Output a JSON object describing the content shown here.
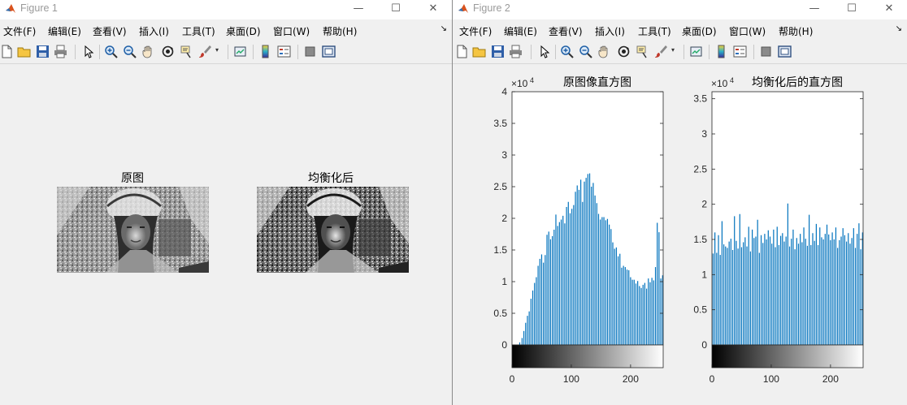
{
  "windows": [
    {
      "title": "Figure 1",
      "menu": [
        "文件(F)",
        "编辑(E)",
        "查看(V)",
        "插入(I)",
        "工具(T)",
        "桌面(D)",
        "窗口(W)",
        "帮助(H)"
      ],
      "images": [
        {
          "title": "原图"
        },
        {
          "title": "均衡化后"
        }
      ]
    },
    {
      "title": "Figure 2",
      "menu": [
        "文件(F)",
        "编辑(E)",
        "查看(V)",
        "插入(I)",
        "工具(T)",
        "桌面(D)",
        "窗口(W)",
        "帮助(H)"
      ]
    }
  ],
  "toolbar_icons": [
    "new-file-icon",
    "open-folder-icon",
    "save-icon",
    "print-icon",
    "arrow-pointer-icon",
    "zoom-in-icon",
    "zoom-out-icon",
    "pan-hand-icon",
    "rotate-3d-icon",
    "data-cursor-icon",
    "brush-icon",
    "brush-dropdown-icon",
    "link-plot-icon",
    "colorbar-icon",
    "legend-icon",
    "hide-plot-tools-icon",
    "show-plot-tools-icon"
  ],
  "window_controls": {
    "minimize": "—",
    "maximize": "☐",
    "close": "✕"
  },
  "colors": {
    "bar": "#0072bd",
    "axes": "#262626",
    "title_inactive": "#9a9a9a"
  },
  "chart_data": [
    {
      "type": "bar",
      "title": "原图像直方图",
      "exponent_label": "×10",
      "exponent": "4",
      "xlim": [
        0,
        255
      ],
      "ylim": [
        0,
        40000
      ],
      "xticks": [
        "0",
        "100",
        "200"
      ],
      "xtick_values": [
        0,
        100,
        200
      ],
      "yticks": [
        "0",
        "0.5",
        "1",
        "1.5",
        "2",
        "2.5",
        "3",
        "3.5",
        "4"
      ],
      "ytick_values": [
        0,
        5000,
        10000,
        15000,
        20000,
        25000,
        30000,
        35000,
        40000
      ],
      "colorbar": "gray",
      "bins": [
        [
          13,
          400
        ],
        [
          17,
          1100
        ],
        [
          20,
          2200
        ],
        [
          23,
          3500
        ],
        [
          26,
          4600
        ],
        [
          29,
          5300
        ],
        [
          32,
          7300
        ],
        [
          35,
          8600
        ],
        [
          38,
          9800
        ],
        [
          41,
          10700
        ],
        [
          44,
          12500
        ],
        [
          47,
          13600
        ],
        [
          50,
          14300
        ],
        [
          53,
          13000
        ],
        [
          56,
          14200
        ],
        [
          59,
          17400
        ],
        [
          62,
          17900
        ],
        [
          65,
          16700
        ],
        [
          68,
          17200
        ],
        [
          71,
          18200
        ],
        [
          74,
          20600
        ],
        [
          77,
          18800
        ],
        [
          80,
          19400
        ],
        [
          83,
          19800
        ],
        [
          86,
          20400
        ],
        [
          89,
          19200
        ],
        [
          92,
          21800
        ],
        [
          95,
          22600
        ],
        [
          98,
          20800
        ],
        [
          101,
          21500
        ],
        [
          104,
          22100
        ],
        [
          107,
          24200
        ],
        [
          110,
          25200
        ],
        [
          113,
          24500
        ],
        [
          116,
          26100
        ],
        [
          119,
          22600
        ],
        [
          122,
          25800
        ],
        [
          125,
          26400
        ],
        [
          128,
          27000
        ],
        [
          131,
          27100
        ],
        [
          134,
          25000
        ],
        [
          137,
          25600
        ],
        [
          140,
          23600
        ],
        [
          143,
          22400
        ],
        [
          146,
          20700
        ],
        [
          149,
          19800
        ],
        [
          152,
          20200
        ],
        [
          155,
          20200
        ],
        [
          158,
          19700
        ],
        [
          161,
          19900
        ],
        [
          164,
          19000
        ],
        [
          167,
          18300
        ],
        [
          170,
          16200
        ],
        [
          173,
          15200
        ],
        [
          176,
          15400
        ],
        [
          179,
          14000
        ],
        [
          182,
          14400
        ],
        [
          185,
          12200
        ],
        [
          188,
          12500
        ],
        [
          191,
          12300
        ],
        [
          194,
          11900
        ],
        [
          197,
          11800
        ],
        [
          200,
          10700
        ],
        [
          203,
          10300
        ],
        [
          206,
          10300
        ],
        [
          209,
          9700
        ],
        [
          212,
          10100
        ],
        [
          215,
          9300
        ],
        [
          218,
          9000
        ],
        [
          221,
          9500
        ],
        [
          224,
          9800
        ],
        [
          227,
          8900
        ],
        [
          230,
          10500
        ],
        [
          233,
          9900
        ],
        [
          236,
          10600
        ],
        [
          239,
          10200
        ],
        [
          242,
          12300
        ],
        [
          245,
          19300
        ],
        [
          248,
          17800
        ],
        [
          251,
          10500
        ],
        [
          254,
          11000
        ]
      ]
    },
    {
      "type": "bar",
      "title": "均衡化后的直方图",
      "exponent_label": "×10",
      "exponent": "4",
      "xlim": [
        0,
        255
      ],
      "ylim": [
        0,
        36000
      ],
      "xticks": [
        "0",
        "100",
        "200"
      ],
      "xtick_values": [
        0,
        100,
        200
      ],
      "yticks": [
        "0",
        "0.5",
        "1",
        "1.5",
        "2",
        "2.5",
        "3",
        "3.5"
      ],
      "ytick_values": [
        0,
        5000,
        10000,
        15000,
        20000,
        25000,
        30000,
        35000
      ],
      "colorbar": "gray",
      "bins": [
        [
          2,
          13000
        ],
        [
          5,
          16000
        ],
        [
          8,
          13100
        ],
        [
          11,
          15600
        ],
        [
          14,
          12800
        ],
        [
          17,
          17600
        ],
        [
          20,
          14300
        ],
        [
          23,
          14000
        ],
        [
          26,
          13800
        ],
        [
          29,
          14700
        ],
        [
          32,
          15100
        ],
        [
          35,
          13500
        ],
        [
          38,
          18300
        ],
        [
          41,
          14800
        ],
        [
          44,
          13700
        ],
        [
          47,
          18600
        ],
        [
          50,
          13900
        ],
        [
          53,
          14600
        ],
        [
          56,
          15300
        ],
        [
          59,
          14000
        ],
        [
          62,
          16800
        ],
        [
          65,
          13300
        ],
        [
          68,
          16400
        ],
        [
          71,
          15200
        ],
        [
          74,
          15400
        ],
        [
          77,
          17800
        ],
        [
          80,
          13100
        ],
        [
          83,
          15600
        ],
        [
          86,
          14500
        ],
        [
          89,
          15800
        ],
        [
          92,
          15000
        ],
        [
          95,
          16300
        ],
        [
          98,
          15400
        ],
        [
          101,
          14400
        ],
        [
          104,
          16400
        ],
        [
          107,
          13900
        ],
        [
          110,
          16800
        ],
        [
          113,
          14200
        ],
        [
          116,
          15500
        ],
        [
          119,
          15900
        ],
        [
          122,
          14700
        ],
        [
          125,
          15400
        ],
        [
          128,
          20100
        ],
        [
          131,
          14000
        ],
        [
          134,
          15100
        ],
        [
          137,
          16400
        ],
        [
          140,
          13600
        ],
        [
          143,
          15200
        ],
        [
          146,
          14400
        ],
        [
          149,
          15800
        ],
        [
          152,
          14600
        ],
        [
          155,
          16700
        ],
        [
          158,
          15100
        ],
        [
          161,
          14100
        ],
        [
          164,
          18500
        ],
        [
          167,
          14200
        ],
        [
          170,
          15900
        ],
        [
          173,
          14800
        ],
        [
          176,
          17200
        ],
        [
          179,
          14200
        ],
        [
          182,
          16700
        ],
        [
          185,
          15300
        ],
        [
          188,
          15000
        ],
        [
          191,
          15800
        ],
        [
          194,
          17100
        ],
        [
          197,
          15700
        ],
        [
          200,
          14900
        ],
        [
          203,
          16000
        ],
        [
          206,
          15000
        ],
        [
          209,
          16700
        ],
        [
          212,
          13800
        ],
        [
          215,
          14900
        ],
        [
          218,
          15400
        ],
        [
          221,
          16600
        ],
        [
          224,
          15600
        ],
        [
          227,
          14700
        ],
        [
          230,
          15900
        ],
        [
          233,
          14400
        ],
        [
          236,
          15200
        ],
        [
          239,
          16600
        ],
        [
          242,
          13800
        ],
        [
          245,
          15800
        ],
        [
          248,
          17300
        ],
        [
          251,
          13600
        ],
        [
          254,
          16000
        ]
      ]
    }
  ]
}
